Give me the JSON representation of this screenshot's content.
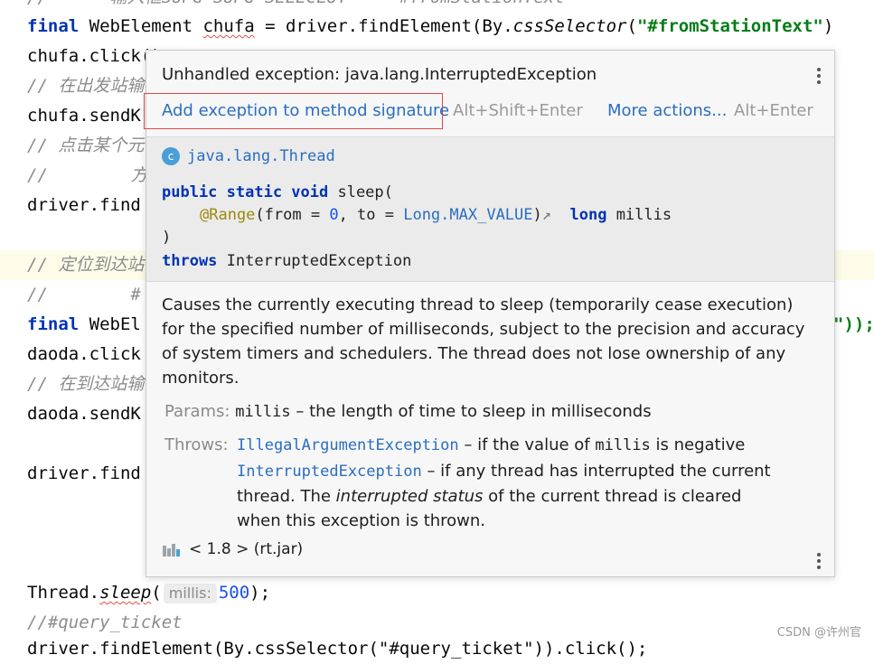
{
  "editor": {
    "line0_comment": "//      输入框SUPG SUPG SELECLUT     #fromStationText",
    "line1_kw": "final",
    "line1_rest": " WebElement ",
    "line1_var": "chufa",
    "line1_mid": " = driver.findElement(By.",
    "line1_method": "cssSelector",
    "line1_paren": "(",
    "line1_str": "\"#fromStationText\"",
    "line1_end": ")",
    "line2": "chufa.click();",
    "line3_comment": "// 在出发站输",
    "line4": "chufa.sendK",
    "line5_comment": "// 点击某个元",
    "line6_comment": "//        方",
    "line7": "driver.find",
    "line9_comment": "// 定位到达站",
    "line10_comment": "//        #",
    "line11_kw": "final",
    "line11_rest": " WebEl",
    "line11_end": "\"));",
    "line12": "daoda.click",
    "line13_comment": "// 在到达站输",
    "line14": "daoda.sendK",
    "line16": "driver.find",
    "line20_pre": "Thread.",
    "line20_method": "sleep",
    "line20_paren": "(",
    "line20_hint": "millis:",
    "line20_num": "500",
    "line20_end": ");",
    "line21_comment": "//#query_ticket",
    "line22_partial": "driver.findElement(By.cssSelector(\"#query_ticket\")).click();"
  },
  "popup": {
    "title": "Unhandled exception: java.lang.InterruptedException",
    "primary_action": "Add exception to method signature",
    "primary_shortcut": "Alt+Shift+Enter",
    "more_actions": "More actions...",
    "more_shortcut": "Alt+Enter",
    "class_icon_letter": "c",
    "class_name": "java.lang.Thread",
    "sig_kw": "public static void",
    "sig_name": " sleep(",
    "sig_annot": "@Range",
    "sig_from": "(from = ",
    "sig_zero": "0",
    "sig_to": ", to = ",
    "sig_max": "Long.MAX_VALUE",
    "sig_close": ")",
    "sig_arrow": "↗",
    "sig_long": "long",
    "sig_millis": " millis",
    "sig_close2": ")",
    "throws_kw": "throws",
    "throws_type": " InterruptedException",
    "description": "Causes the currently executing thread to sleep (temporarily cease execution) for the specified number of milliseconds, subject to the precision and accuracy of system timers and schedulers. The thread does not lose ownership of any monitors.",
    "params_label": "Params:",
    "param_name": "millis",
    "param_desc": " – the length of time to sleep in milliseconds",
    "throws_label": "Throws:",
    "throw1_type": "IllegalArgumentException",
    "throw1_desc_a": " – if the value of ",
    "throw1_code": "millis",
    "throw1_desc_b": " is negative",
    "throw2_type": "InterruptedException",
    "throw2_desc_a": " – if any thread has interrupted the current",
    "throw2_line2_a": "thread. The ",
    "throw2_italic": "interrupted status",
    "throw2_line2_b": " of the current thread is cleared",
    "throw2_line3": "when this exception is thrown.",
    "footer": "< 1.8 > (rt.jar)"
  },
  "watermark": "CSDN @许州官",
  "colors": {
    "keyword": "#0033b3",
    "string": "#067d17",
    "comment": "#8c8c8c",
    "link": "#2a6ec1",
    "highlight_box": "#e04848"
  }
}
